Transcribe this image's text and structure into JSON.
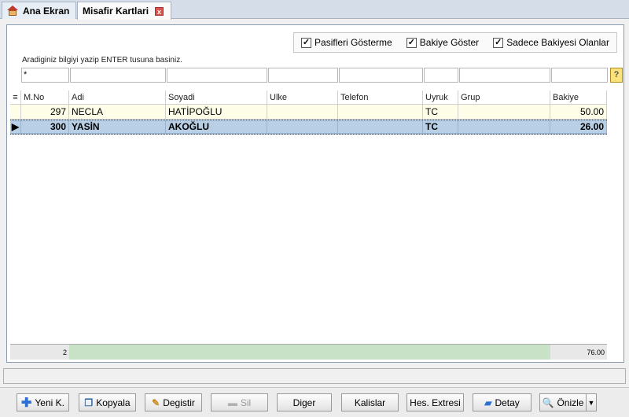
{
  "tabs": [
    {
      "label": "Ana Ekran"
    },
    {
      "label": "Misafir Kartlari"
    }
  ],
  "options": {
    "pasifleri": "Pasifleri Gösterme",
    "bakiye": "Bakiye Göster",
    "sadece": "Sadece Bakiyesi Olanlar"
  },
  "hint": "Aradiginiz bilgiyi yazip ENTER tusuna basiniz.",
  "filter": {
    "mno_value": "*"
  },
  "columns": [
    "M.No",
    "Adi",
    "Soyadi",
    "Ulke",
    "Telefon",
    "Uyruk",
    "Grup",
    "Bakiye"
  ],
  "rows": [
    {
      "mno": "297",
      "adi": "NECLA",
      "soyadi": "HATİPOĞLU",
      "ulke": "",
      "telefon": "",
      "uyruk": "TC",
      "grup": "",
      "bakiye": "50.00"
    },
    {
      "mno": "300",
      "adi": "YASİN",
      "soyadi": "AKOĞLU",
      "ulke": "",
      "telefon": "",
      "uyruk": "TC",
      "grup": "",
      "bakiye": "26.00"
    }
  ],
  "summary": {
    "count": "2",
    "total": "76.00"
  },
  "buttons": {
    "yeni": "Yeni K.",
    "kopyala": "Kopyala",
    "degistir": "Degistir",
    "sil": "Sil",
    "diger": "Diger",
    "kalislar": "Kalislar",
    "hes": "Hes. Extresi",
    "detay": "Detay",
    "onizle": "Önizle"
  },
  "colors": {
    "selected_row": "#b8cfe6",
    "summary_fill": "#c8e2c8",
    "filter_button": "#fbe27a"
  }
}
